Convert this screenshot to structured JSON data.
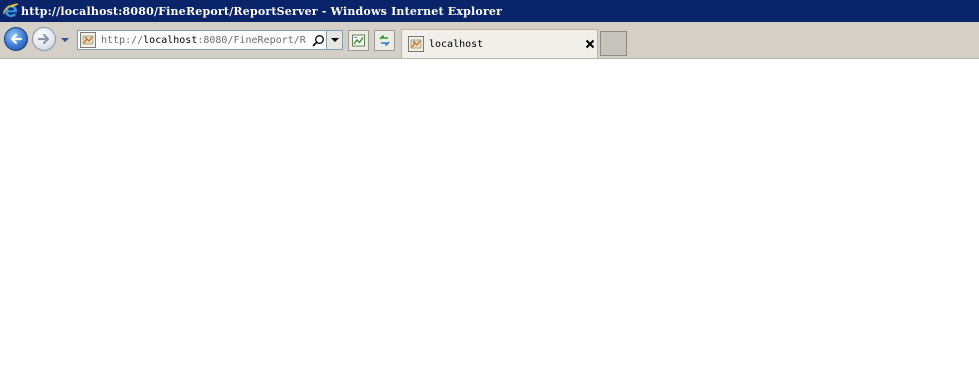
{
  "window": {
    "title": "http://localhost:8080/FineReport/ReportServer - Windows Internet Explorer"
  },
  "toolbar": {
    "address": {
      "prefix": "http://",
      "host": "localhost",
      "suffix": ":8080/FineReport/R"
    },
    "tabs": [
      {
        "label": "localhost",
        "close_glyph": "✕"
      }
    ]
  },
  "colors": {
    "titlebar": "#0a246a",
    "toolbar": "#d4d0c8",
    "content": "#ffffff"
  },
  "icons": {
    "title": "ie-logo-icon",
    "back": "back-arrow-icon",
    "forward": "forward-arrow-icon",
    "recent": "chevron-down-icon",
    "favicon": "page-favicon-icon",
    "search": "search-icon",
    "compat": "compatibility-view-icon",
    "refresh": "refresh-icon",
    "close": "close-icon"
  }
}
